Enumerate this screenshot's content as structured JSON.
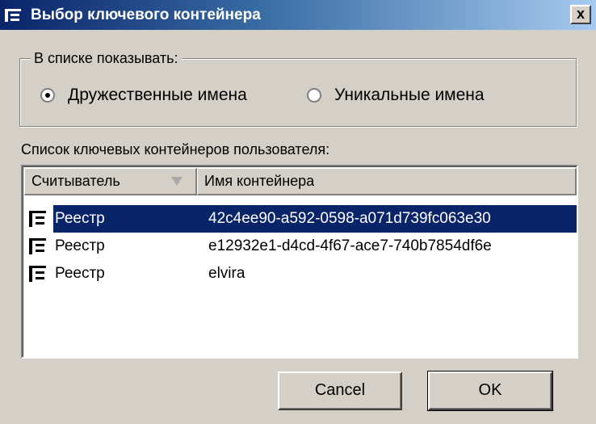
{
  "window": {
    "title": "Выбор ключевого контейнера",
    "close_label": "x"
  },
  "display_group": {
    "legend": "В списке показывать:",
    "options": [
      {
        "label": "Дружественные имена",
        "checked": true
      },
      {
        "label": "Уникальные имена",
        "checked": false
      }
    ]
  },
  "list": {
    "caption": "Список ключевых контейнеров пользователя:",
    "columns": [
      "Считыватель",
      "Имя контейнера"
    ],
    "sort_icon": "sort-descending-icon",
    "rows": [
      {
        "reader": "Реестр",
        "container": "42c4ee90-a592-0598-a071d739fc063e30",
        "selected": true,
        "icon": "key-icon"
      },
      {
        "reader": "Реестр",
        "container": "e12932e1-d4cd-4f67-ace7-740b7854df6e",
        "selected": false,
        "icon": "key-icon"
      },
      {
        "reader": "Реестр",
        "container": "elvira",
        "selected": false,
        "icon": "key-icon"
      }
    ]
  },
  "buttons": {
    "cancel": "Cancel",
    "ok": "OK"
  },
  "colors": {
    "title_start": "#0a246a",
    "title_end": "#a6caf0",
    "selection": "#0a246a",
    "dialog_face": "#d4d0c8"
  }
}
